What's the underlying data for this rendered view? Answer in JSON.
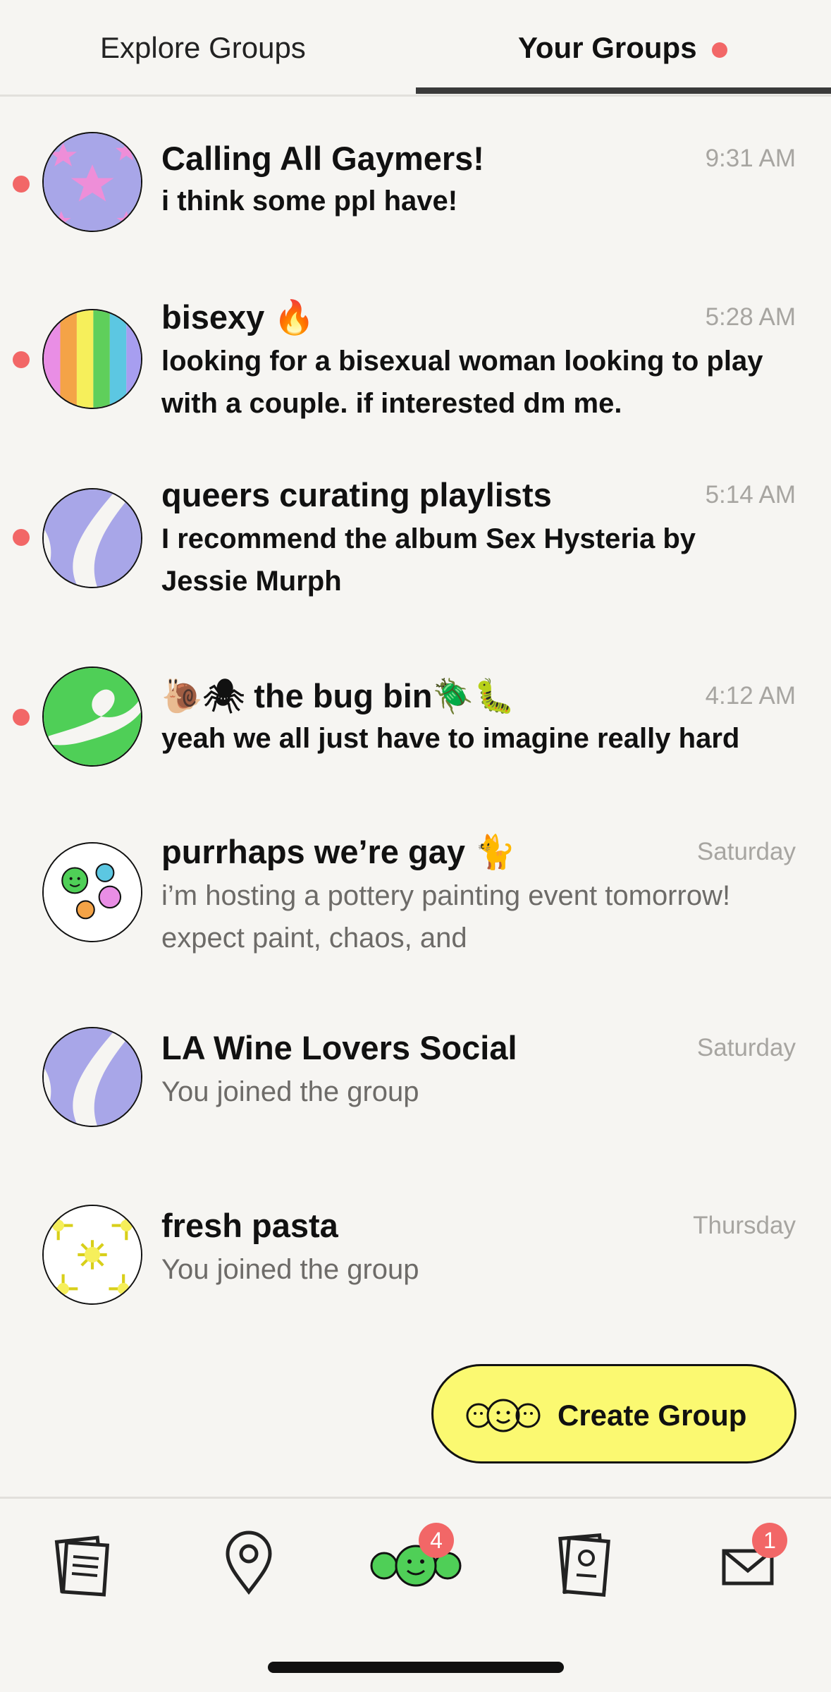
{
  "tabs": {
    "explore_label": "Explore Groups",
    "yours_label": "Your Groups",
    "active": "yours"
  },
  "groups": [
    {
      "name": "Calling All Gaymers!",
      "time": "9:31 AM",
      "message": "i think some ppl have!",
      "unread": true,
      "avatar": "purple-stars"
    },
    {
      "name": "bisexy 🔥",
      "time": "5:28 AM",
      "message": "looking for a bisexual woman looking to play with a couple. if interested dm me.",
      "unread": true,
      "avatar": "rainbow-stripes"
    },
    {
      "name": "queers curating playlists",
      "time": "5:14 AM",
      "message": "I recommend the album Sex Hysteria by Jessie Murph",
      "unread": true,
      "avatar": "lavender-waves"
    },
    {
      "name": "🐌🕷 the bug bin🪲🐛",
      "time": "4:12 AM",
      "message": "yeah we all just have to imagine really hard",
      "unread": true,
      "avatar": "green-swirl"
    },
    {
      "name": "purrhaps we’re gay 🐈",
      "time": "Saturday",
      "message": "i’m hosting a pottery painting event tomorrow! expect  paint, chaos, and",
      "unread": false,
      "avatar": "smiley-faces"
    },
    {
      "name": "LA Wine Lovers Social",
      "time": "Saturday",
      "message": "You joined the group",
      "unread": false,
      "avatar": "lavender-waves"
    },
    {
      "name": "fresh pasta",
      "time": "Thursday",
      "message": "You joined the group",
      "unread": false,
      "avatar": "yellow-flowers"
    }
  ],
  "create_button": {
    "label": "Create Group",
    "icon": "three-faces-icon"
  },
  "bottom_nav": {
    "items": [
      {
        "name": "feed",
        "icon": "newspaper-icon"
      },
      {
        "name": "map",
        "icon": "location-pin-icon"
      },
      {
        "name": "groups",
        "icon": "groups-faces-icon",
        "badge": "4"
      },
      {
        "name": "profile",
        "icon": "profile-card-icon"
      },
      {
        "name": "messages",
        "icon": "envelope-icon",
        "badge": "1"
      }
    ]
  },
  "colors": {
    "background": "#f6f5f2",
    "unread_dot": "#f26767",
    "create_button": "#fbf971",
    "time_text": "#a7a5a1"
  }
}
